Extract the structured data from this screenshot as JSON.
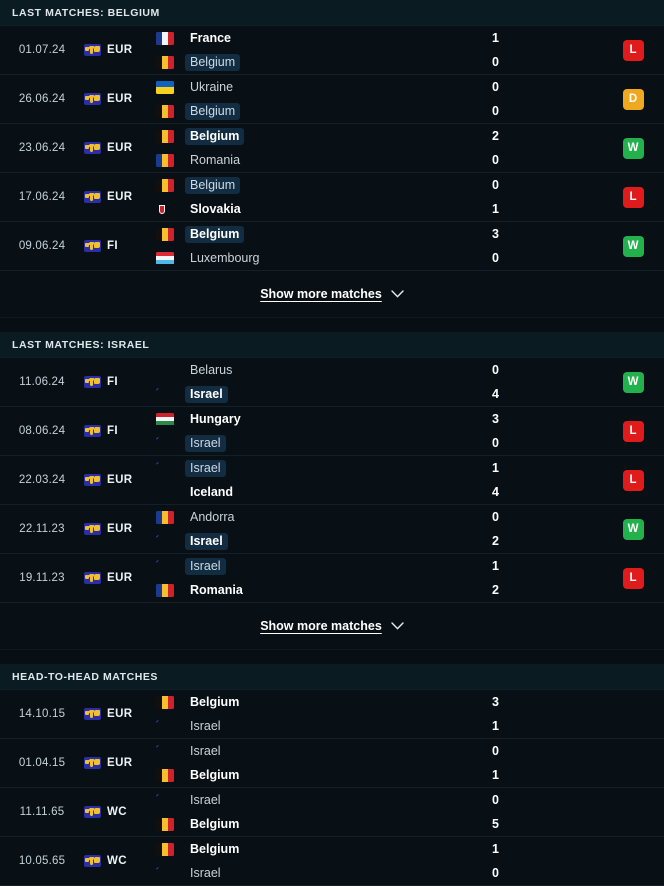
{
  "meta": {
    "show_more_label": "Show more matches",
    "chevron_icon": "chevron-down-icon",
    "competition_icon": "world-map-icon"
  },
  "sections": [
    {
      "id": "last-matches-belgium",
      "title": "LAST MATCHES: BELGIUM",
      "has_show_more": true,
      "matches": [
        {
          "date": "01.07.24",
          "competition": "EUR",
          "home": {
            "name": "France",
            "flag": "france",
            "bold": true,
            "highlight": false
          },
          "away": {
            "name": "Belgium",
            "flag": "belgium",
            "bold": false,
            "highlight": true
          },
          "home_score": "1",
          "away_score": "0",
          "result": "L"
        },
        {
          "date": "26.06.24",
          "competition": "EUR",
          "home": {
            "name": "Ukraine",
            "flag": "ukraine",
            "bold": false,
            "highlight": false
          },
          "away": {
            "name": "Belgium",
            "flag": "belgium",
            "bold": false,
            "highlight": true
          },
          "home_score": "0",
          "away_score": "0",
          "result": "D"
        },
        {
          "date": "23.06.24",
          "competition": "EUR",
          "home": {
            "name": "Belgium",
            "flag": "belgium",
            "bold": true,
            "highlight": true
          },
          "away": {
            "name": "Romania",
            "flag": "romania",
            "bold": false,
            "highlight": false
          },
          "home_score": "2",
          "away_score": "0",
          "result": "W"
        },
        {
          "date": "17.06.24",
          "competition": "EUR",
          "home": {
            "name": "Belgium",
            "flag": "belgium",
            "bold": false,
            "highlight": true
          },
          "away": {
            "name": "Slovakia",
            "flag": "slovakia",
            "bold": true,
            "highlight": false
          },
          "home_score": "0",
          "away_score": "1",
          "result": "L"
        },
        {
          "date": "09.06.24",
          "competition": "FI",
          "home": {
            "name": "Belgium",
            "flag": "belgium",
            "bold": true,
            "highlight": true
          },
          "away": {
            "name": "Luxembourg",
            "flag": "luxembourg",
            "bold": false,
            "highlight": false
          },
          "home_score": "3",
          "away_score": "0",
          "result": "W"
        }
      ]
    },
    {
      "id": "last-matches-israel",
      "title": "LAST MATCHES: ISRAEL",
      "has_show_more": true,
      "matches": [
        {
          "date": "11.06.24",
          "competition": "FI",
          "home": {
            "name": "Belarus",
            "flag": "belarus",
            "bold": false,
            "highlight": false
          },
          "away": {
            "name": "Israel",
            "flag": "israel",
            "bold": true,
            "highlight": true
          },
          "home_score": "0",
          "away_score": "4",
          "result": "W"
        },
        {
          "date": "08.06.24",
          "competition": "FI",
          "home": {
            "name": "Hungary",
            "flag": "hungary",
            "bold": true,
            "highlight": false
          },
          "away": {
            "name": "Israel",
            "flag": "israel",
            "bold": false,
            "highlight": true
          },
          "home_score": "3",
          "away_score": "0",
          "result": "L"
        },
        {
          "date": "22.03.24",
          "competition": "EUR",
          "home": {
            "name": "Israel",
            "flag": "israel",
            "bold": false,
            "highlight": true
          },
          "away": {
            "name": "Iceland",
            "flag": "iceland",
            "bold": true,
            "highlight": false
          },
          "home_score": "1",
          "away_score": "4",
          "result": "L"
        },
        {
          "date": "22.11.23",
          "competition": "EUR",
          "home": {
            "name": "Andorra",
            "flag": "andorra",
            "bold": false,
            "highlight": false
          },
          "away": {
            "name": "Israel",
            "flag": "israel",
            "bold": true,
            "highlight": true
          },
          "home_score": "0",
          "away_score": "2",
          "result": "W"
        },
        {
          "date": "19.11.23",
          "competition": "EUR",
          "home": {
            "name": "Israel",
            "flag": "israel",
            "bold": false,
            "highlight": true
          },
          "away": {
            "name": "Romania",
            "flag": "romania",
            "bold": true,
            "highlight": false
          },
          "home_score": "1",
          "away_score": "2",
          "result": "L"
        }
      ]
    },
    {
      "id": "head-to-head-matches",
      "title": "HEAD-TO-HEAD MATCHES",
      "has_show_more": false,
      "matches": [
        {
          "date": "14.10.15",
          "competition": "EUR",
          "home": {
            "name": "Belgium",
            "flag": "belgium",
            "bold": true,
            "highlight": false
          },
          "away": {
            "name": "Israel",
            "flag": "israel",
            "bold": false,
            "highlight": false
          },
          "home_score": "3",
          "away_score": "1",
          "result": ""
        },
        {
          "date": "01.04.15",
          "competition": "EUR",
          "home": {
            "name": "Israel",
            "flag": "israel",
            "bold": false,
            "highlight": false
          },
          "away": {
            "name": "Belgium",
            "flag": "belgium",
            "bold": true,
            "highlight": false
          },
          "home_score": "0",
          "away_score": "1",
          "result": ""
        },
        {
          "date": "11.11.65",
          "competition": "WC",
          "home": {
            "name": "Israel",
            "flag": "israel",
            "bold": false,
            "highlight": false
          },
          "away": {
            "name": "Belgium",
            "flag": "belgium",
            "bold": true,
            "highlight": false
          },
          "home_score": "0",
          "away_score": "5",
          "result": ""
        },
        {
          "date": "10.05.65",
          "competition": "WC",
          "home": {
            "name": "Belgium",
            "flag": "belgium",
            "bold": true,
            "highlight": false
          },
          "away": {
            "name": "Israel",
            "flag": "israel",
            "bold": false,
            "highlight": false
          },
          "home_score": "1",
          "away_score": "0",
          "result": ""
        }
      ]
    }
  ],
  "colors": {
    "win": "#22b14c",
    "loss": "#e01b1b",
    "draw": "#f0a81e",
    "header_bg": "#0b1b22",
    "row_bg": "#080f15",
    "highlight_bg": "#122c41"
  }
}
